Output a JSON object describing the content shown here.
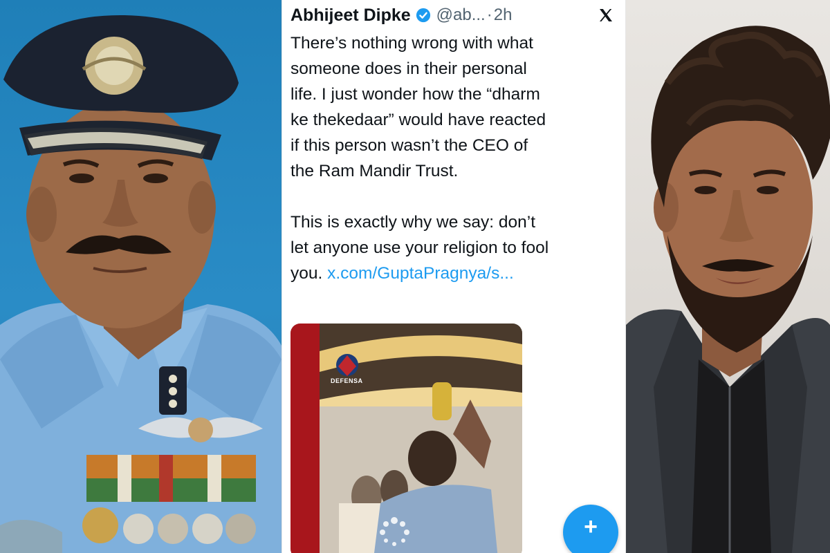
{
  "tweet": {
    "author_name": "Abhijeet Dipke",
    "handle": "@ab...",
    "separator": "·",
    "time": "2h",
    "paragraph1_lines": [
      "There’s nothing wrong with what",
      "someone does in their personal",
      "life. I just wonder how the “dharm",
      "ke thekedaar” would have reacted",
      "if this person wasn’t the CEO of",
      "the Ram Mandir Trust."
    ],
    "paragraph2_lines": [
      "This is exactly why we say: don’t",
      "let anyone use your religion to fool"
    ],
    "paragraph2_last_text": "you. ",
    "link_text": "x.com/GuptaPragnya/s...",
    "media_watermark": "DEFENSA",
    "compose_label": "+"
  },
  "icons": {
    "verified": "verified-badge-icon",
    "platform": "x-logo-icon",
    "compose": "plus-icon"
  },
  "colors": {
    "link": "#1d9bf0",
    "verified": "#1d9bf0",
    "text": "#0f1419",
    "muted": "#536471",
    "left_background": "#2a8cc6"
  }
}
